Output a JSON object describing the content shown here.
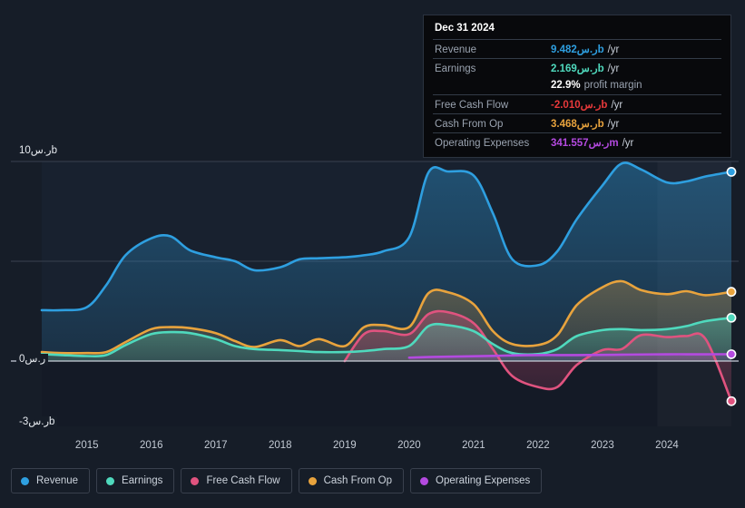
{
  "tooltip": {
    "date": "Dec 31 2024",
    "rows": [
      {
        "name": "Revenue",
        "value": "9.482ر.سb",
        "unit": "/yr",
        "color": "#2e9fe0"
      },
      {
        "name": "Earnings",
        "value": "2.169ر.سb",
        "unit": "/yr",
        "color": "#4fd9bd"
      },
      {
        "name": "",
        "value": "22.9%",
        "unit": "profit margin",
        "color": "#ffffff",
        "sub": true
      },
      {
        "name": "Free Cash Flow",
        "value": "-2.010ر.سb",
        "unit": "/yr",
        "color": "#e8393b"
      },
      {
        "name": "Cash From Op",
        "value": "3.468ر.سb",
        "unit": "/yr",
        "color": "#e8a33d"
      },
      {
        "name": "Operating Expenses",
        "value": "341.557ر.سm",
        "unit": "/yr",
        "color": "#b44ae0"
      }
    ]
  },
  "axis": {
    "y_top": "10ر.سb",
    "y_zero": "0ر.س",
    "y_bottom": "-3ر.سb",
    "x_labels": [
      "2015",
      "2016",
      "2017",
      "2018",
      "2019",
      "2020",
      "2021",
      "2022",
      "2023",
      "2024"
    ]
  },
  "legend": [
    {
      "label": "Revenue",
      "color": "#2e9fe0"
    },
    {
      "label": "Earnings",
      "color": "#4fd9bd"
    },
    {
      "label": "Free Cash Flow",
      "color": "#e0537f"
    },
    {
      "label": "Cash From Op",
      "color": "#e8a33d"
    },
    {
      "label": "Operating Expenses",
      "color": "#b44ae0"
    }
  ],
  "chart_data": {
    "type": "area",
    "title": "",
    "xlabel": "",
    "ylabel": "ر.س",
    "xlim": [
      2014.3,
      2025.0
    ],
    "ylim": [
      -3,
      10.3
    ],
    "yticks": [
      -3,
      0,
      5,
      10
    ],
    "grid": true,
    "legend_position": "bottom",
    "highlight_band": [
      2023.85,
      2025.0
    ],
    "x": [
      2014.3,
      2014.6,
      2015.0,
      2015.3,
      2015.6,
      2016.0,
      2016.3,
      2016.6,
      2017.0,
      2017.3,
      2017.6,
      2018.0,
      2018.3,
      2018.6,
      2019.0,
      2019.3,
      2019.6,
      2020.0,
      2020.3,
      2020.6,
      2021.0,
      2021.3,
      2021.6,
      2022.0,
      2022.3,
      2022.6,
      2023.0,
      2023.3,
      2023.6,
      2024.0,
      2024.3,
      2024.6,
      2025.0
    ],
    "series": [
      {
        "name": "Revenue",
        "color": "#2e9fe0",
        "values": [
          2.55,
          2.55,
          2.7,
          3.8,
          5.3,
          6.15,
          6.25,
          5.55,
          5.2,
          5.0,
          4.55,
          4.7,
          5.1,
          5.15,
          5.2,
          5.3,
          5.5,
          6.2,
          9.45,
          9.5,
          9.3,
          7.4,
          5.1,
          4.8,
          5.5,
          7.1,
          8.8,
          9.9,
          9.6,
          8.95,
          9.0,
          9.25,
          9.482
        ]
      },
      {
        "name": "Earnings",
        "color": "#4fd9bd",
        "values": [
          0.35,
          0.3,
          0.25,
          0.3,
          0.8,
          1.35,
          1.45,
          1.4,
          1.1,
          0.75,
          0.6,
          0.55,
          0.5,
          0.45,
          0.45,
          0.5,
          0.6,
          0.75,
          1.75,
          1.8,
          1.5,
          0.85,
          0.4,
          0.35,
          0.6,
          1.25,
          1.55,
          1.6,
          1.55,
          1.6,
          1.75,
          2.0,
          2.169
        ]
      },
      {
        "name": "Free Cash Flow",
        "color": "#e0537f",
        "values": [
          null,
          null,
          null,
          null,
          null,
          null,
          null,
          null,
          null,
          null,
          null,
          null,
          null,
          null,
          0.0,
          1.35,
          1.5,
          1.35,
          2.35,
          2.45,
          1.9,
          0.6,
          -0.75,
          -1.3,
          -1.3,
          -0.2,
          0.55,
          0.6,
          1.3,
          1.2,
          1.25,
          1.1,
          -2.01
        ]
      },
      {
        "name": "Cash From Op",
        "color": "#e8a33d",
        "values": [
          0.45,
          0.4,
          0.4,
          0.45,
          0.95,
          1.6,
          1.7,
          1.65,
          1.4,
          1.0,
          0.7,
          1.05,
          0.75,
          1.1,
          0.75,
          1.7,
          1.8,
          1.7,
          3.4,
          3.45,
          2.85,
          1.5,
          0.85,
          0.8,
          1.3,
          2.8,
          3.7,
          4.0,
          3.55,
          3.35,
          3.5,
          3.3,
          3.468
        ]
      },
      {
        "name": "Operating Expenses",
        "color": "#b44ae0",
        "values": [
          null,
          null,
          null,
          null,
          null,
          null,
          null,
          null,
          null,
          null,
          null,
          null,
          null,
          null,
          null,
          null,
          null,
          0.17,
          0.2,
          0.22,
          0.24,
          0.26,
          0.28,
          0.3,
          0.3,
          0.3,
          0.31,
          0.32,
          0.33,
          0.34,
          0.34,
          0.34,
          0.341557
        ]
      }
    ]
  }
}
